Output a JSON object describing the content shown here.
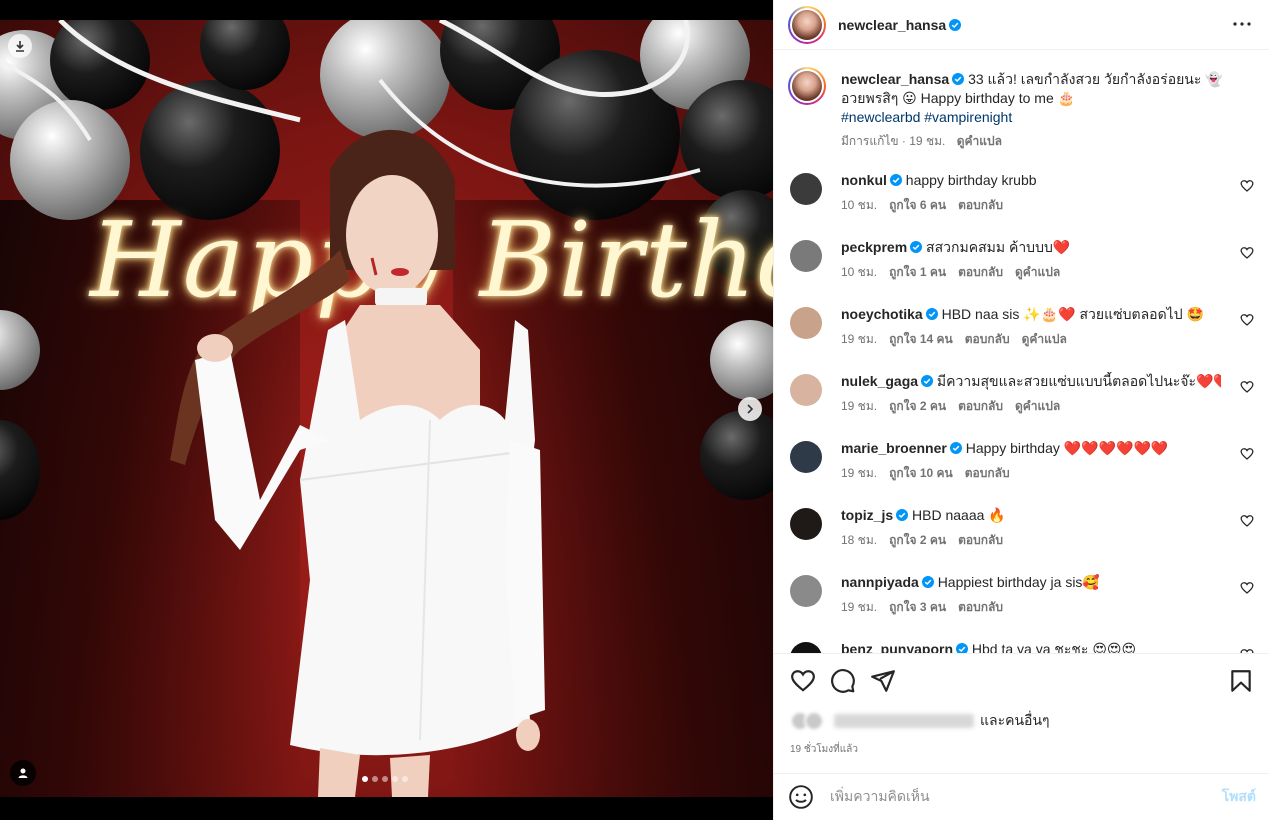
{
  "post": {
    "username": "newclear_hansa",
    "more_icon": "more-horizontal-icon",
    "carousel": {
      "slide_count": 5,
      "active_slide": 1
    },
    "neon_text": "Happy Birthday"
  },
  "caption": {
    "username": "newclear_hansa",
    "text": "33 แล้ว! เลขกำลังสวย วัยกำลังอร่อยนะ 👻 อวยพรสิๆ 😛 Happy birthday to me 🎂",
    "hashtags": "#newclearbd #vampirenight",
    "edited": "มีการแก้ไข · 19 ชม.",
    "translate": "ดูคำแปล"
  },
  "comments": [
    {
      "username": "nonkul",
      "text": "happy birthday krubb",
      "time": "10 ชม.",
      "likes": "ถูกใจ 6 คน",
      "reply": "ตอบกลับ",
      "translate": "",
      "avatar_color": "#3b3b3b"
    },
    {
      "username": "peckprem",
      "text": "สสวกมคสมม ค้าบบบ❤️",
      "time": "10 ชม.",
      "likes": "ถูกใจ 1 คน",
      "reply": "ตอบกลับ",
      "translate": "ดูคำแปล",
      "avatar_color": "#7a7a7a"
    },
    {
      "username": "noeychotika",
      "text": "HBD naa sis ✨🎂❤️ สวยแซ่บตลอดไป 🤩",
      "time": "19 ชม.",
      "likes": "ถูกใจ 14 คน",
      "reply": "ตอบกลับ",
      "translate": "ดูคำแปล",
      "avatar_color": "#c9a28c"
    },
    {
      "username": "nulek_gaga",
      "text": "มีความสุขและสวยแซ่บแบบนี้ตลอดไปนะจ๊ะ❤️❤️",
      "time": "19 ชม.",
      "likes": "ถูกใจ 2 คน",
      "reply": "ตอบกลับ",
      "translate": "ดูคำแปล",
      "avatar_color": "#d8b3a0"
    },
    {
      "username": "marie_broenner",
      "text": "Happy birthday ❤️❤️❤️❤️❤️❤️",
      "time": "19 ชม.",
      "likes": "ถูกใจ 10 คน",
      "reply": "ตอบกลับ",
      "translate": "",
      "avatar_color": "#2f3a48"
    },
    {
      "username": "topiz_js",
      "text": "HBD naaaa 🔥",
      "time": "18 ชม.",
      "likes": "ถูกใจ 2 คน",
      "reply": "ตอบกลับ",
      "translate": "",
      "avatar_color": "#1f1a17"
    },
    {
      "username": "nannpiyada",
      "text": "Happiest birthday ja sis🥰",
      "time": "19 ชม.",
      "likes": "ถูกใจ 3 คน",
      "reply": "ตอบกลับ",
      "translate": "",
      "avatar_color": "#8a8a8a"
    },
    {
      "username": "benz_punyaporn",
      "text": "Hbd ta ya ya ชะชะ 😍😍😍",
      "time": "",
      "likes": "",
      "reply": "",
      "translate": "",
      "avatar_color": "#111111"
    }
  ],
  "actions": {
    "like_icon": "heart-icon",
    "comment_icon": "comment-icon",
    "share_icon": "send-icon",
    "save_icon": "bookmark-icon",
    "likes_suffix": "และคนอื่นๆ",
    "time_ago": "19 ชั่วโมงที่แล้ว"
  },
  "add_comment": {
    "placeholder": "เพิ่มความคิดเห็น",
    "post_label": "โพสต์",
    "emoji_icon": "smiley-icon"
  }
}
